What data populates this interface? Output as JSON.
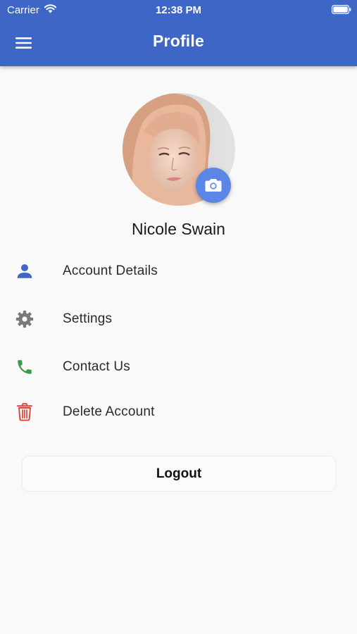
{
  "status_bar": {
    "carrier": "Carrier",
    "time": "12:38 PM"
  },
  "header": {
    "title": "Profile",
    "menu_icon": "hamburger-menu-icon",
    "background": "#3e66c7"
  },
  "profile": {
    "name": "Nicole Swain",
    "camera_icon": "camera-icon",
    "camera_color": "#5b86e5"
  },
  "menu": {
    "items": [
      {
        "label": "Account Details",
        "icon": "person-icon",
        "color": "#3e66c7"
      },
      {
        "label": "Settings",
        "icon": "gear-icon",
        "color": "#7a7a7a"
      },
      {
        "label": "Contact Us",
        "icon": "phone-icon",
        "color": "#3a9a48"
      },
      {
        "label": "Delete Account",
        "icon": "trash-icon",
        "color": "#e0413a"
      }
    ]
  },
  "logout": {
    "label": "Logout"
  }
}
